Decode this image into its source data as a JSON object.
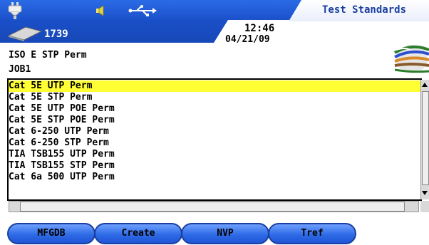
{
  "header": {
    "title": "Test Standards",
    "remote_id": "1739",
    "time": "12:46",
    "date": "04/21/09",
    "icons": [
      "plug-icon",
      "speaker-icon",
      "usb-icon",
      "remote-handset-icon",
      "cable-bundle-icon"
    ]
  },
  "info": {
    "line1": "ISO E STP Perm",
    "line2": "JOB1"
  },
  "list": {
    "items": [
      "Cat 5E UTP Perm",
      "Cat 5E STP Perm",
      "Cat 5E UTP POE Perm",
      "Cat 5E STP POE Perm",
      "Cat 6-250 UTP Perm",
      "Cat 6-250 STP Perm",
      "TIA TSB155 UTP Perm",
      "TIA TSB155 STP Perm",
      "Cat 6a 500 UTP Perm"
    ],
    "selected_index": 0
  },
  "buttons": {
    "mfgdb": "MFGDB",
    "create": "Create",
    "nvp": "NVP",
    "tref": "Tref"
  },
  "colors": {
    "header_blue": "#1f55d6",
    "selection": "#ffff33",
    "button_blue": "#2f6be6"
  }
}
